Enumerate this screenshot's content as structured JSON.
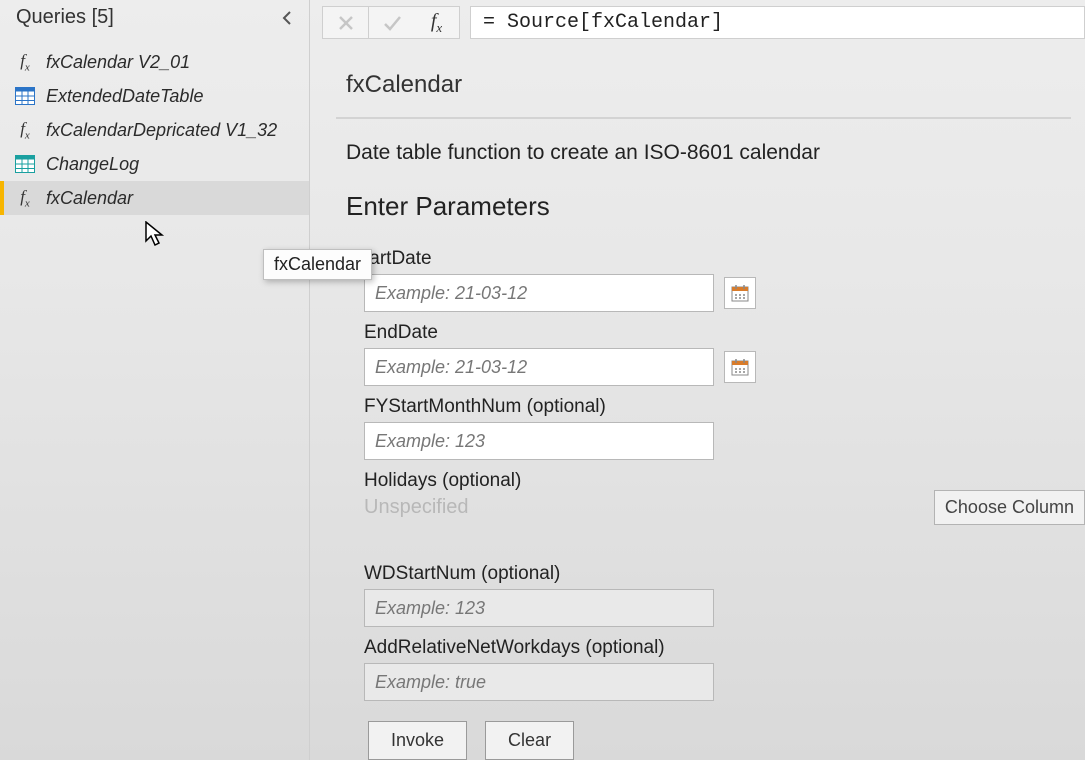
{
  "sidebar": {
    "title": "Queries [5]",
    "items": [
      {
        "label": "fxCalendar V2_01",
        "iconType": "fx",
        "selected": false
      },
      {
        "label": "ExtendedDateTable",
        "iconType": "table-blue",
        "selected": false
      },
      {
        "label": "fxCalendarDepricated V1_32",
        "iconType": "fx",
        "selected": false
      },
      {
        "label": "ChangeLog",
        "iconType": "table-teal",
        "selected": false
      },
      {
        "label": "fxCalendar",
        "iconType": "fx",
        "selected": true
      }
    ],
    "tooltip": "fxCalendar"
  },
  "formula_bar": {
    "value": "= Source[fxCalendar]"
  },
  "function": {
    "name": "fxCalendar",
    "description": "Date table function to create an ISO-8601 calendar"
  },
  "parameters": {
    "heading": "Enter Parameters",
    "fields": {
      "startdate": {
        "label": "tartDate",
        "placeholder": "Example: 21-03-12"
      },
      "enddate": {
        "label": "EndDate",
        "placeholder": "Example: 21-03-12"
      },
      "fystart": {
        "label": "FYStartMonthNum (optional)",
        "placeholder": "Example: 123"
      },
      "holidays": {
        "label": "Holidays (optional)",
        "unspecified": "Unspecified"
      },
      "wdstart": {
        "label": "WDStartNum (optional)",
        "placeholder": "Example: 123"
      },
      "addrel": {
        "label": "AddRelativeNetWorkdays (optional)",
        "placeholder": "Example: true"
      }
    }
  },
  "buttons": {
    "invoke": "Invoke",
    "clear": "Clear",
    "choose_column": "Choose Column"
  }
}
